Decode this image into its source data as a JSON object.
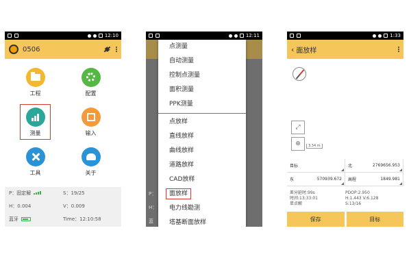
{
  "phone1": {
    "status": {
      "time": "12:10"
    },
    "header": {
      "title": "0506"
    },
    "tiles": [
      {
        "label": "工程",
        "icon": "folder-icon",
        "color": "#f2b830"
      },
      {
        "label": "配置",
        "icon": "gear-icon",
        "color": "#55b844"
      },
      {
        "label": "测量",
        "icon": "survey-icon",
        "color": "#2aa79a"
      },
      {
        "label": "输入",
        "icon": "edit-icon",
        "color": "#f59a3c"
      },
      {
        "label": "工具",
        "icon": "tools-icon",
        "color": "#2a93d6"
      },
      {
        "label": "关于",
        "icon": "about-icon",
        "color": "#2a93d6"
      }
    ],
    "panel": {
      "p": "P：固定解",
      "s": "S：19/25",
      "h": "H：0.004",
      "v": "V：0.009",
      "bt": "蓝牙",
      "time": "Time：12:10:58"
    }
  },
  "phone2": {
    "status": {
      "time": "12:11"
    },
    "menu_group1": [
      "点测量",
      "自动测量",
      "控制点测量",
      "面积测量",
      "PPK测量"
    ],
    "menu_group2": [
      "点放样",
      "直线放样",
      "曲线放样",
      "道路放样",
      "CAD放样",
      "面放样",
      "电力线勘测",
      "塔基断面放样"
    ],
    "bg": {
      "p": "P：",
      "h": "H：",
      "bt": "蓝"
    }
  },
  "phone3": {
    "status": {
      "time": "1:33"
    },
    "header": {
      "title": "面放样"
    },
    "scale_label": "3.34 m",
    "grid": {
      "target_label": "目标",
      "north_label": "北",
      "north_value": "2769656.953",
      "east_label": "东",
      "east_value": "570939.672",
      "elev_label": "高程",
      "elev_value": "1849.981"
    },
    "info": {
      "diff_delay": "差分延时:99s",
      "time": "时间:13:33:01",
      "single": "单点解",
      "pdop": "PDOP:2.950",
      "hv": "H:1.443  V:6.128",
      "s": "S:13/16"
    },
    "buttons": {
      "save": "保存",
      "target": "目标"
    }
  },
  "colors": {
    "accent": "#f5c65a",
    "highlight": "#d83a2e"
  }
}
